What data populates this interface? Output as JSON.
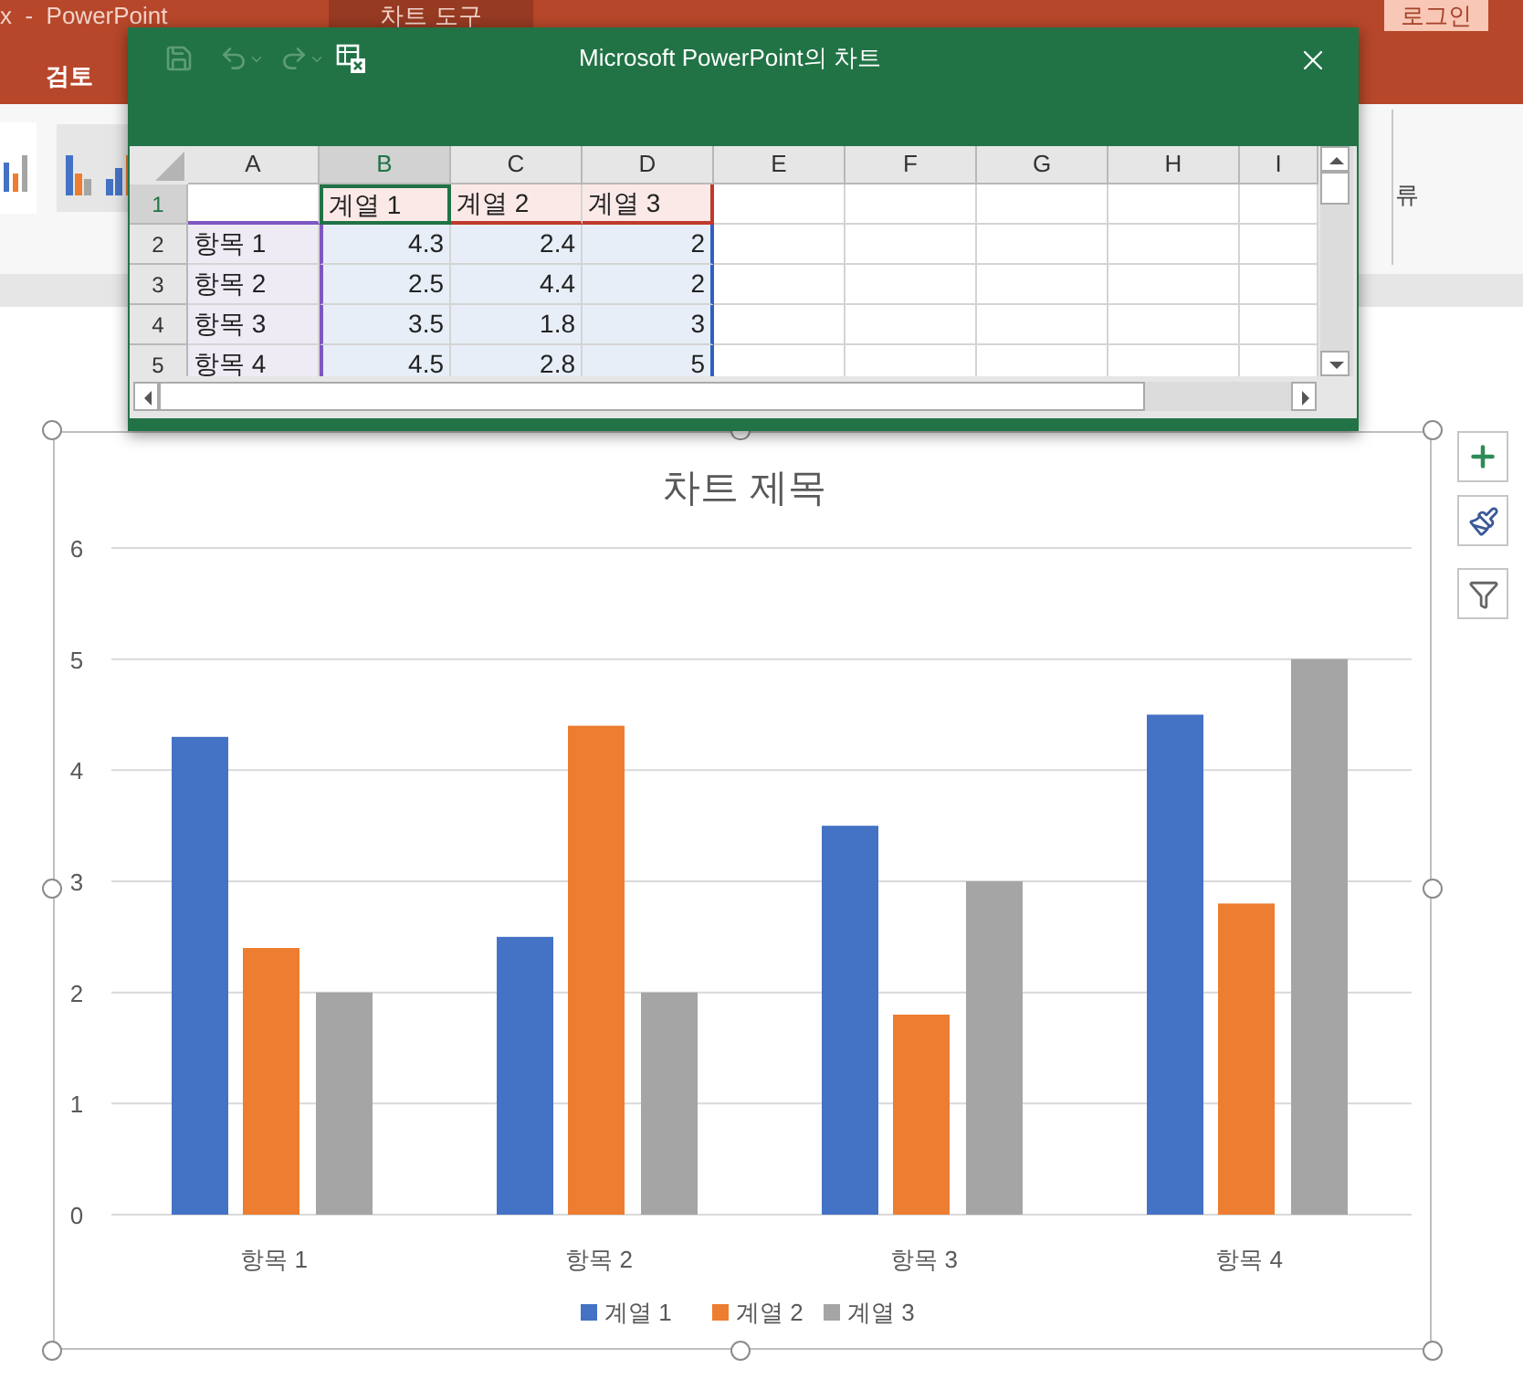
{
  "app": {
    "title": "x  -  PowerPoint",
    "context_tab": "차트 도구",
    "tabs": [
      {
        "label": "검토"
      }
    ],
    "login_button": "로그인",
    "ribbon_label": "류"
  },
  "spreadsheet_window": {
    "title": "Microsoft PowerPoint의 차트",
    "columns": [
      {
        "label": "A",
        "selected": false
      },
      {
        "label": "B",
        "selected": true
      },
      {
        "label": "C",
        "selected": false
      },
      {
        "label": "D",
        "selected": false
      },
      {
        "label": "E",
        "selected": false
      },
      {
        "label": "F",
        "selected": false
      },
      {
        "label": "G",
        "selected": false
      },
      {
        "label": "H",
        "selected": false
      },
      {
        "label": "I",
        "selected": false
      }
    ],
    "rows": [
      {
        "label": "1",
        "selected": true,
        "cells": [
          "",
          "계열 1",
          "계열 2",
          "계열 3"
        ]
      },
      {
        "label": "2",
        "selected": false,
        "cells": [
          "항목 1",
          "4.3",
          "2.4",
          "2"
        ]
      },
      {
        "label": "3",
        "selected": false,
        "cells": [
          "항목 2",
          "2.5",
          "4.4",
          "2"
        ]
      },
      {
        "label": "4",
        "selected": false,
        "cells": [
          "항목 3",
          "3.5",
          "1.8",
          "3"
        ]
      },
      {
        "label": "5",
        "selected": false,
        "cells": [
          "항목 4",
          "4.5",
          "2.8",
          "5"
        ]
      }
    ]
  },
  "chart": {
    "chart_data": {
      "type": "bar",
      "title": "차트 제목",
      "categories": [
        "항목 1",
        "항목 2",
        "항목 3",
        "항목 4"
      ],
      "series": [
        {
          "name": "계열 1",
          "color": "#4472c4",
          "values": [
            4.3,
            2.5,
            3.5,
            4.5
          ]
        },
        {
          "name": "계열 2",
          "color": "#ed7d31",
          "values": [
            2.4,
            4.4,
            1.8,
            2.8
          ]
        },
        {
          "name": "계열 3",
          "color": "#a5a5a5",
          "values": [
            2,
            2,
            3,
            5
          ]
        }
      ],
      "ylim": [
        0,
        6
      ],
      "yticks": [
        0,
        1,
        2,
        3,
        4,
        5,
        6
      ],
      "grid": true,
      "legend": true
    }
  }
}
